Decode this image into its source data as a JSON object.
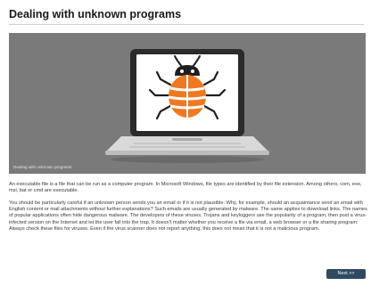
{
  "page": {
    "title": "Dealing with unknown programs"
  },
  "figure": {
    "caption": "Dealing with unknown programs",
    "icon": "laptop-with-bug-icon",
    "colors": {
      "background": "#7a7a7a",
      "screen": "#ffffff",
      "bug_body": "#f07820",
      "bug_head": "#1f1f1f"
    }
  },
  "content": {
    "paragraph_1": "An executable file is a file that can be run as a computer program. In Microsoft Windows, file types are identified by their file extension. Among others, com, exe, msi, bat or cmd are executable.",
    "paragraph_2": "You should be particularly careful if an unknown person sends you an email or if it is not plausible: Why, for example, should an acquaintance send an email with English content or mail attachments without further explanations? Such emails are usually generated by malware. The same applies to download links. The names of popular applications often hide dangerous malware. The developers of these viruses, Trojans and keyloggers use the popularity of a program, then post a virus-infected version on the Internet and let the user fall into the trap. It doesn't matter whether you receive a file via email, a web browser or a file sharing program: Always check these files for viruses. Even if the virus scanner does not report anything, this does not mean that it is not a malicious program."
  },
  "navigation": {
    "next_label": "Next >>"
  }
}
